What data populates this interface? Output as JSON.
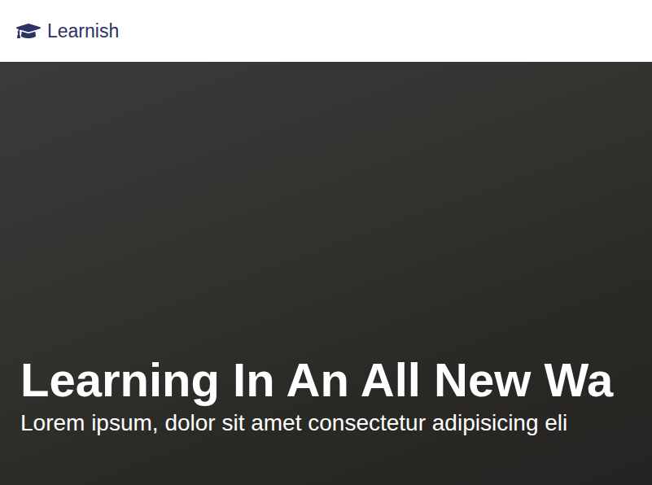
{
  "header": {
    "brand": "Learnish"
  },
  "hero": {
    "title": "Learning In An All New Wa",
    "subtitle": "Lorem ipsum, dolor sit amet consectetur adipisicing eli"
  }
}
